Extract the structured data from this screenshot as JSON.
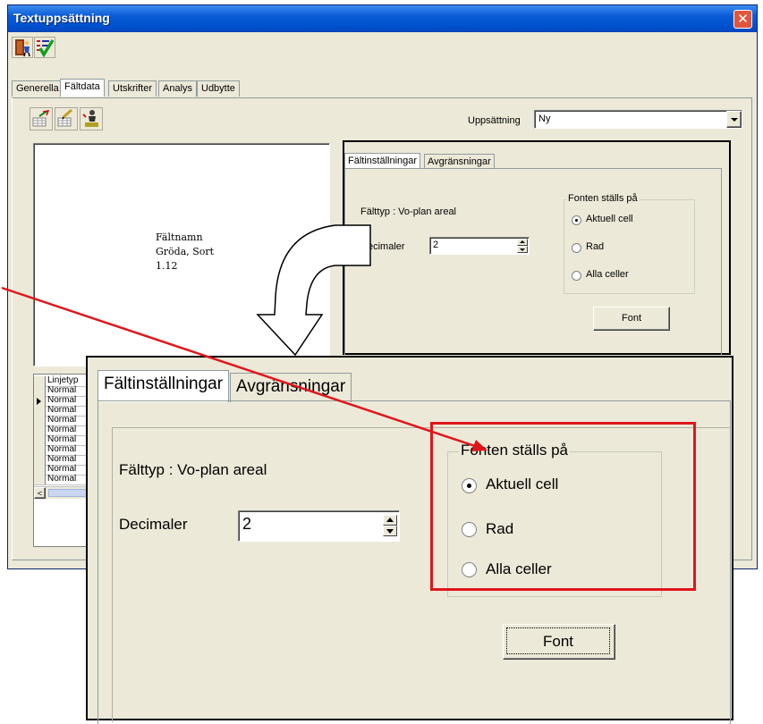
{
  "window": {
    "title": "Textuppsättning",
    "close_symbol": "✕"
  },
  "toolbar": {
    "icons": [
      "exit-door-icon",
      "checklist-approve-icon"
    ]
  },
  "main_tabs": [
    {
      "label": "Generella",
      "active": false
    },
    {
      "label": "Fältdata",
      "active": true
    },
    {
      "label": "Utskrifter",
      "active": false
    },
    {
      "label": "Analys",
      "active": false
    },
    {
      "label": "Udbytte",
      "active": false
    }
  ],
  "subtoolbar": {
    "icons": [
      "grid-edit-icon",
      "grid-pencil-icon",
      "person-pedestal-icon"
    ]
  },
  "uppsattning": {
    "label": "Uppsättning",
    "value": "Ny"
  },
  "preview": {
    "line1": "Fältnamn",
    "line2": "Gröda, Sort",
    "line3": "1.12"
  },
  "grid": {
    "header": "Linjetyp",
    "rows": [
      "Normal",
      "Normal",
      "Normal",
      "Normal",
      "Normal",
      "Normal",
      "Normal",
      "Normal",
      "Normal",
      "Normal"
    ],
    "current_row_index": 1
  },
  "field_panel": {
    "tabs": [
      {
        "label": "Fältinställningar",
        "active": true
      },
      {
        "label": "Avgränsningar",
        "active": false
      }
    ],
    "small_decimaler_label": "ecimaler",
    "falttyp": "Fälttyp : Vo-plan areal",
    "decimaler_label": "Decimaler",
    "decimaler_value": "2",
    "group_title": "Fonten ställs på",
    "options": [
      {
        "label": "Aktuell cell",
        "selected": true
      },
      {
        "label": "Rad",
        "selected": false
      },
      {
        "label": "Alla celler",
        "selected": false
      }
    ],
    "font_button": "Font"
  },
  "colors": {
    "titlebar": "#0a5bd6",
    "window_bg": "#ece9d8",
    "highlight_red": "#e0161b"
  }
}
